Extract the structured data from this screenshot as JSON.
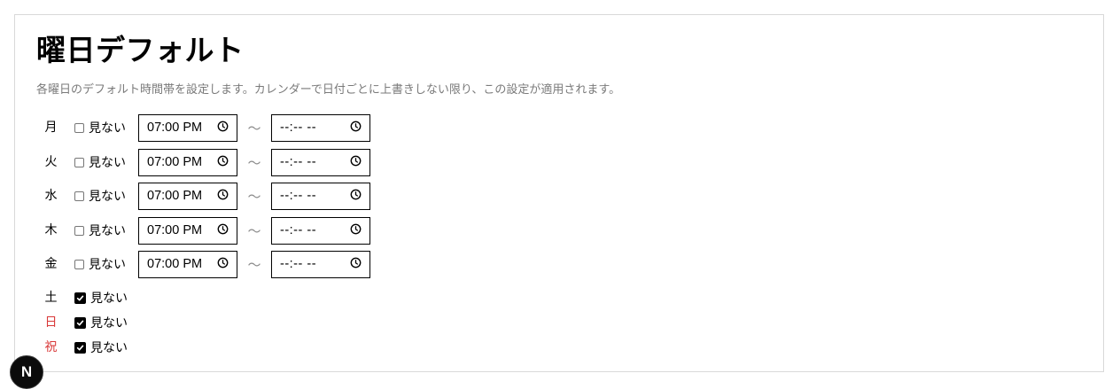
{
  "page": {
    "title": "曜日デフォルト",
    "description": "各曜日のデフォルト時間帯を設定します。カレンダーで日付ごとに上書きしない限り、この設定が適用されます。"
  },
  "separator": "〜",
  "colors": {
    "holiday": "#d93a3a",
    "text": "#000000",
    "muted": "#7a7a7a"
  },
  "days": [
    {
      "label": "月",
      "hide_label": "見ない",
      "hidden": false,
      "start": "07:00 PM",
      "end": "--:-- --",
      "red": false
    },
    {
      "label": "火",
      "hide_label": "見ない",
      "hidden": false,
      "start": "07:00 PM",
      "end": "--:-- --",
      "red": false
    },
    {
      "label": "水",
      "hide_label": "見ない",
      "hidden": false,
      "start": "07:00 PM",
      "end": "--:-- --",
      "red": false
    },
    {
      "label": "木",
      "hide_label": "見ない",
      "hidden": false,
      "start": "07:00 PM",
      "end": "--:-- --",
      "red": false
    },
    {
      "label": "金",
      "hide_label": "見ない",
      "hidden": false,
      "start": "07:00 PM",
      "end": "--:-- --",
      "red": false
    },
    {
      "label": "土",
      "hide_label": "見ない",
      "hidden": true,
      "red": false
    },
    {
      "label": "日",
      "hide_label": "見ない",
      "hidden": true,
      "red": true
    },
    {
      "label": "祝",
      "hide_label": "見ない",
      "hidden": true,
      "red": true
    }
  ],
  "badge": {
    "letter": "N",
    "icon": "nextjs-dev-indicator-icon"
  }
}
